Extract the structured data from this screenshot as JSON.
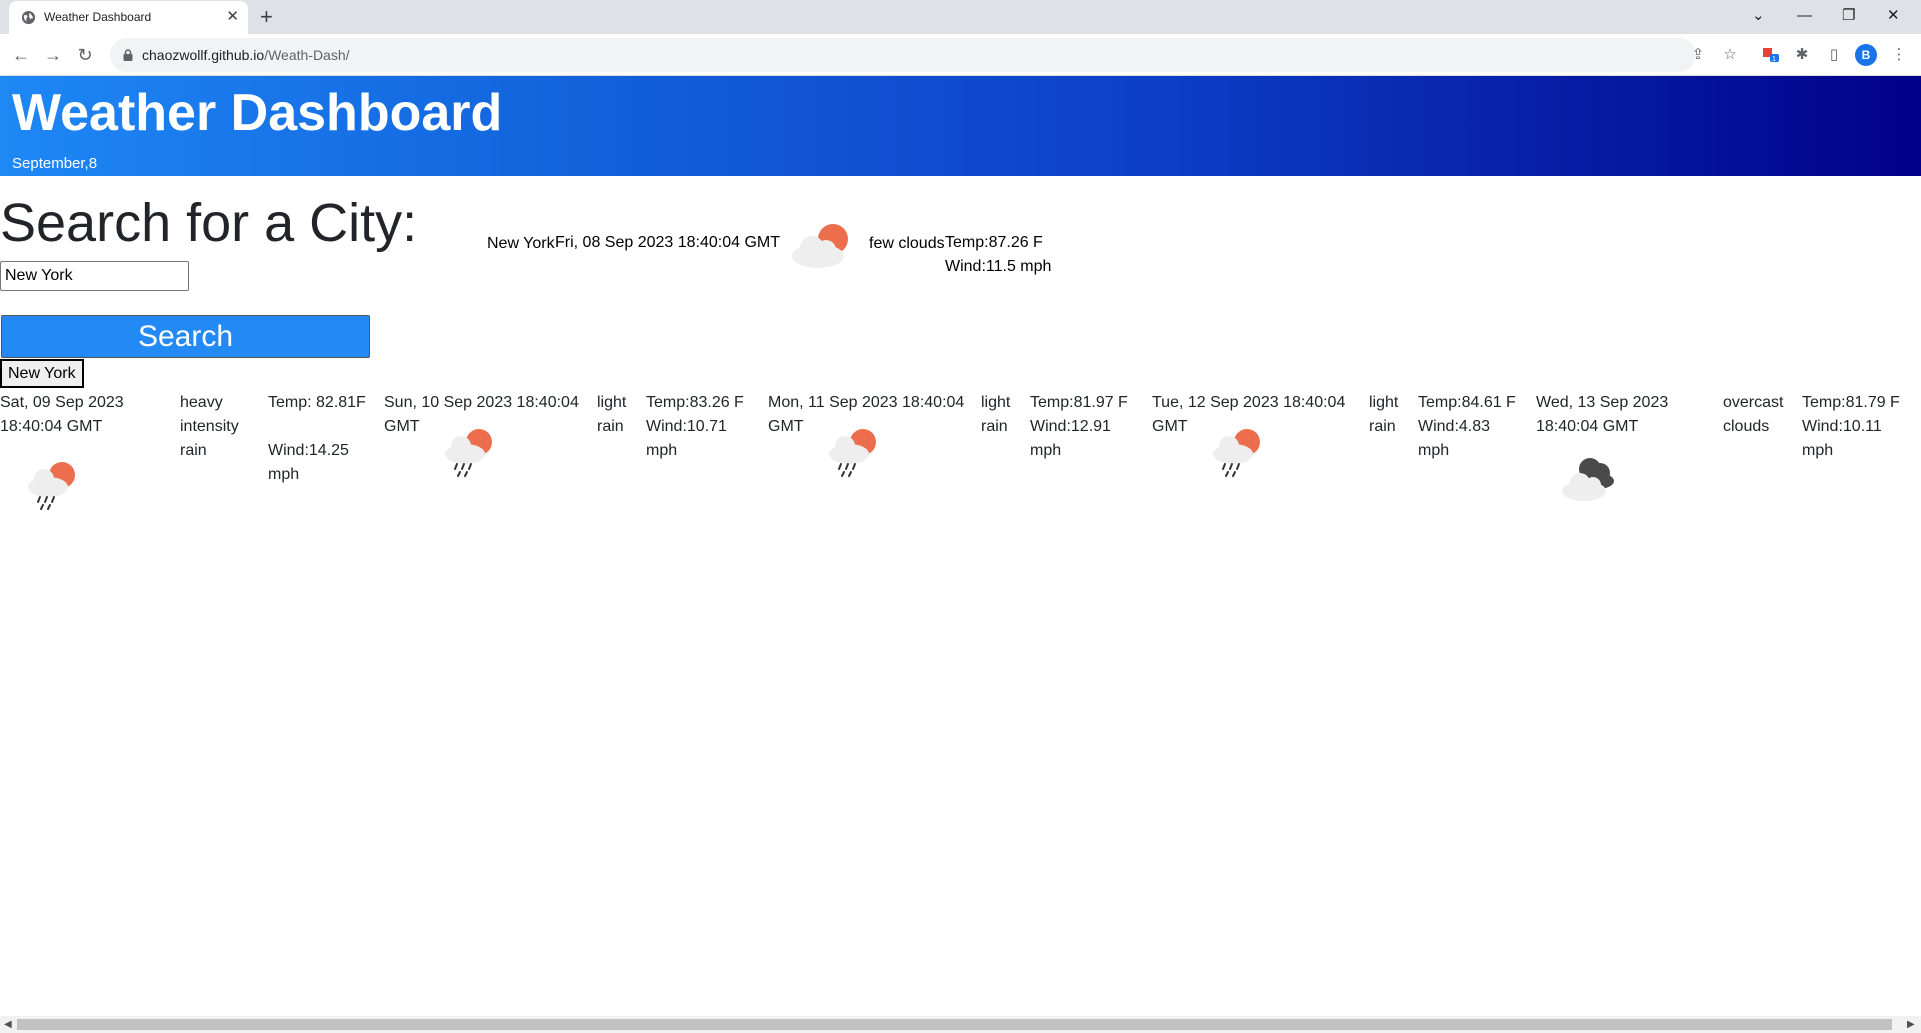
{
  "browser": {
    "tab_title": "Weather Dashboard",
    "tab_close": "✕",
    "new_tab": "+",
    "url_host": "chaozwollf.github.io",
    "url_path": "/Weath-Dash/",
    "profile_initial": "B",
    "extension_badge": "1",
    "window_controls": [
      "⌄",
      "—",
      "❐",
      "✕"
    ]
  },
  "header": {
    "title": "Weather Dashboard",
    "date": "September,8"
  },
  "search": {
    "heading": "Search for a City:",
    "input_value": "New York",
    "button_label": "Search",
    "history": [
      "New York"
    ]
  },
  "current": {
    "city": "New York",
    "datetime": "Fri, 08 Sep 2023 18:40:04 GMT",
    "description": "few clouds",
    "icon": "few-clouds-icon",
    "temp": "Temp:87.26 F",
    "wind": "Wind:11.5 mph"
  },
  "forecast": [
    {
      "date": "Sat, 09 Sep 2023 18:40:04 GMT",
      "description": "heavy intensity rain",
      "temp": "Temp: 82.81F",
      "wind": "Wind:14.25 mph",
      "icon": "rain-icon"
    },
    {
      "date": "Sun, 10 Sep 2023 18:40:04 GMT",
      "description": "light rain",
      "temp": "Temp:83.26 F",
      "wind": "Wind:10.71 mph",
      "icon": "rain-icon"
    },
    {
      "date": "Mon, 11 Sep 2023 18:40:04 GMT",
      "description": "light rain",
      "temp": "Temp:81.97 F",
      "wind": "Wind:12.91 mph",
      "icon": "rain-icon"
    },
    {
      "date": "Tue, 12 Sep 2023 18:40:04 GMT",
      "description": "light rain",
      "temp": "Temp:84.61 F",
      "wind": "Wind:4.83 mph",
      "icon": "rain-icon"
    },
    {
      "date": "Wed, 13 Sep 2023 18:40:04 GMT",
      "description": "overcast clouds",
      "temp": "Temp:81.79 F",
      "wind": "Wind:10.11 mph",
      "icon": "overcast-clouds-icon"
    }
  ],
  "colors": {
    "header_start": "#1e88f5",
    "header_end": "#01008a",
    "search_button": "#2389f5",
    "sun": "#ec6e4c",
    "cloud": "#eeeeee",
    "dark_cloud": "#4a4a4a"
  }
}
